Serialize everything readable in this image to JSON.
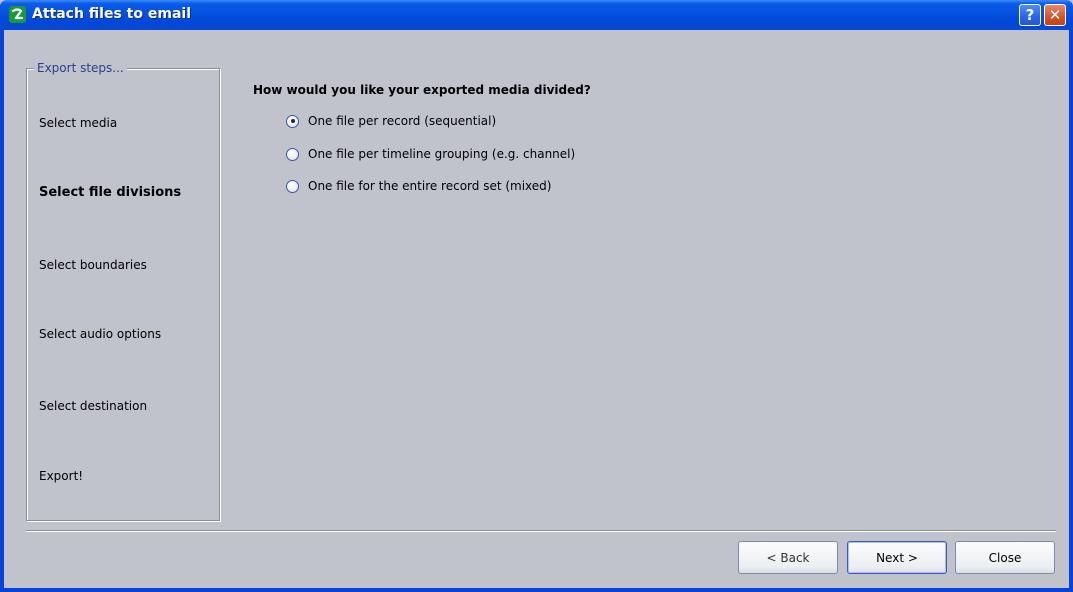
{
  "window": {
    "title": "Attach files to email",
    "icon": "app-logo-icon",
    "help_label": "?",
    "close_label": "✕"
  },
  "steps": {
    "legend": "Export steps...",
    "items": [
      {
        "label": "Select media",
        "active": false
      },
      {
        "label": "Select file divisions",
        "active": true
      },
      {
        "label": "Select boundaries",
        "active": false
      },
      {
        "label": "Select audio options",
        "active": false
      },
      {
        "label": "Select destination",
        "active": false
      },
      {
        "label": "Export!",
        "active": false
      }
    ]
  },
  "main": {
    "question": "How would you like your exported media divided?",
    "options": [
      {
        "label": "One file per record (sequential)",
        "checked": true
      },
      {
        "label": "One file per timeline grouping (e.g. channel)",
        "checked": false
      },
      {
        "label": "One file for the entire record set (mixed)",
        "checked": false
      }
    ]
  },
  "footer": {
    "back_label": "< Back",
    "next_label": "Next >",
    "close_label": "Close"
  },
  "colors": {
    "titlebar": "#0650e0",
    "client_bg": "#c0c3cc",
    "legend_text": "#2a3f8a"
  }
}
